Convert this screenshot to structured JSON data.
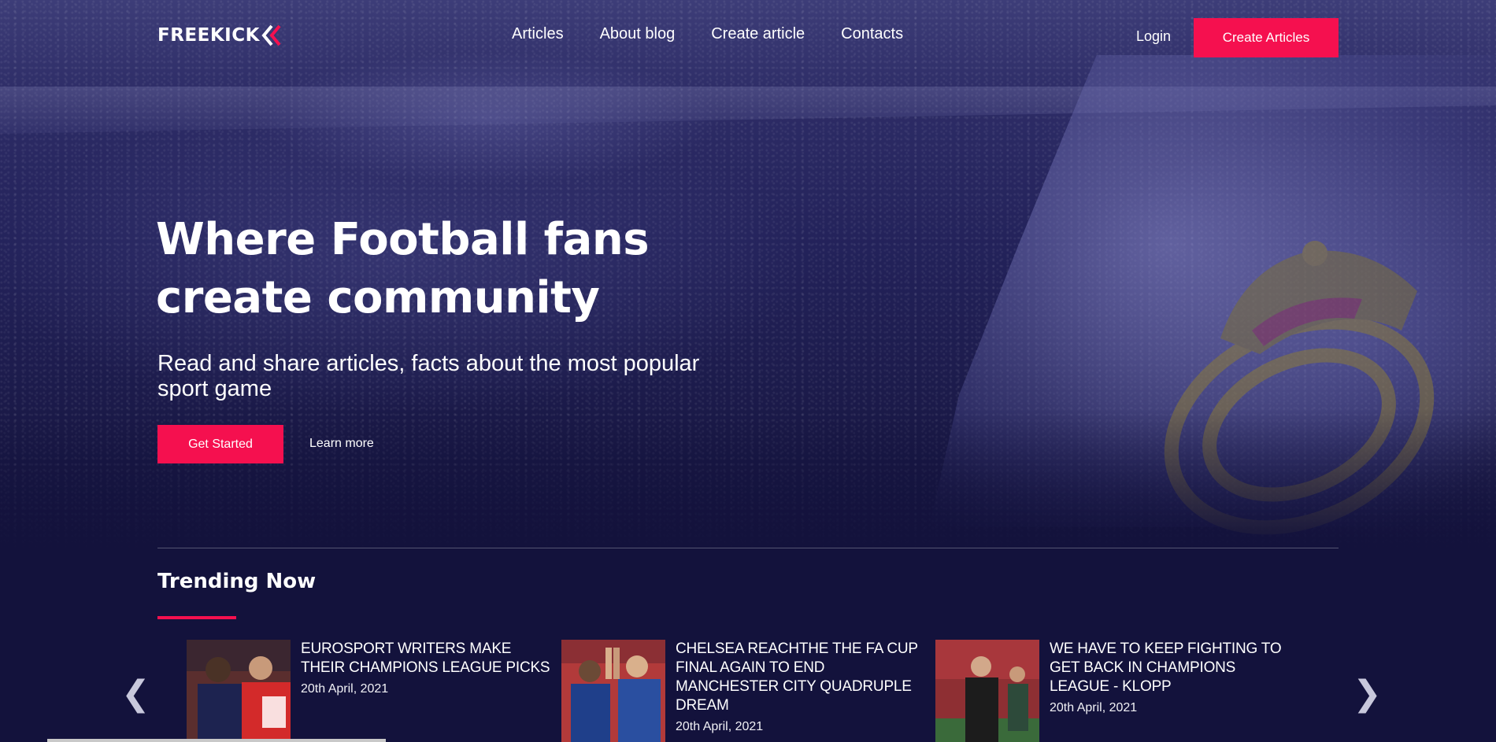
{
  "brand": {
    "logo_text": "FREEKICK"
  },
  "nav": {
    "items": [
      {
        "label": "Articles"
      },
      {
        "label": "About blog"
      },
      {
        "label": "Create article"
      },
      {
        "label": "Contacts"
      }
    ],
    "login_label": "Login",
    "create_articles_label": "Create Articles"
  },
  "hero": {
    "title_line1": "Where Football fans",
    "title_line2": "create community",
    "subtitle": "Read and share articles, facts about the most popular sport game",
    "get_started_label": "Get Started",
    "learn_more_label": "Learn more"
  },
  "trending": {
    "title": "Trending Now",
    "prev_arrow": "❮",
    "next_arrow": "❯",
    "cards": [
      {
        "title": "EUROSPORT WRITERS MAKE THEIR CHAMPIONS LEAGUE PICKS",
        "date": "20th April, 2021"
      },
      {
        "title": "CHELSEA REACHTHE THE FA CUP FINAL AGAIN TO END MANCHESTER CITY QUADRUPLE DREAM",
        "date": "20th April, 2021"
      },
      {
        "title": "WE HAVE TO KEEP FIGHTING TO GET BACK IN CHAMPIONS LEAGUE - KLOPP",
        "date": "20th April, 2021"
      }
    ]
  },
  "colors": {
    "accent": "#f5104f",
    "background": "#13123c"
  }
}
